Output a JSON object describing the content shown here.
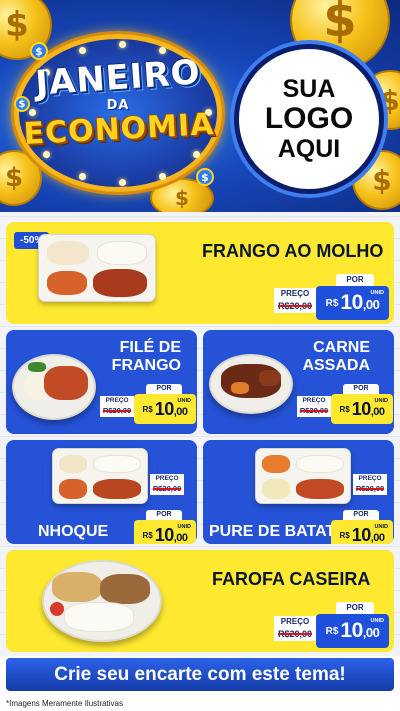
{
  "header": {
    "title_line1": "JANEIRO",
    "title_line2": "DA",
    "title_line3": "ECONOMIA",
    "logo_line1": "SUA",
    "logo_line2": "LOGO",
    "logo_line3": "AQUI",
    "coin_symbol": "$"
  },
  "products": [
    {
      "name": "FRANGO AO MOLHO",
      "discount": "-50%",
      "preco_label": "PREÇO",
      "old_price": "R$20,00",
      "por_label": "POR",
      "currency": "R$",
      "price_int": "10",
      "price_dec": ",00",
      "unit": "UNID"
    },
    {
      "name_line1": "FILÉ DE",
      "name_line2": "FRANGO",
      "preco_label": "PREÇO",
      "old_price": "R$20,00",
      "por_label": "POR",
      "currency": "R$",
      "price_int": "10",
      "price_dec": ",00",
      "unit": "UNID"
    },
    {
      "name_line1": "CARNE",
      "name_line2": "ASSADA",
      "preco_label": "PREÇO",
      "old_price": "R$20,00",
      "por_label": "POR",
      "currency": "R$",
      "price_int": "10",
      "price_dec": ",00",
      "unit": "UNID"
    },
    {
      "name": "NHOQUE",
      "preco_label": "PREÇO",
      "old_price": "R$20,00",
      "por_label": "POR",
      "currency": "R$",
      "price_int": "10",
      "price_dec": ",00",
      "unit": "UNID"
    },
    {
      "name": "PURE DE BATATA",
      "preco_label": "PREÇO",
      "old_price": "R$20,00",
      "por_label": "POR",
      "currency": "R$",
      "price_int": "10",
      "price_dec": ",00",
      "unit": "UNID"
    },
    {
      "name": "FAROFA CASEIRA",
      "preco_label": "PREÇO",
      "old_price": "R$20,00",
      "por_label": "POR",
      "currency": "R$",
      "price_int": "10",
      "price_dec": ",00",
      "unit": "UNID"
    }
  ],
  "cta": {
    "label": "Crie seu encarte com este tema!"
  },
  "footnote": "*Imagens Meramente Ilustrativas",
  "colors": {
    "blue": "#2552d6",
    "yellow": "#ffe930",
    "navy": "#0b1633"
  }
}
